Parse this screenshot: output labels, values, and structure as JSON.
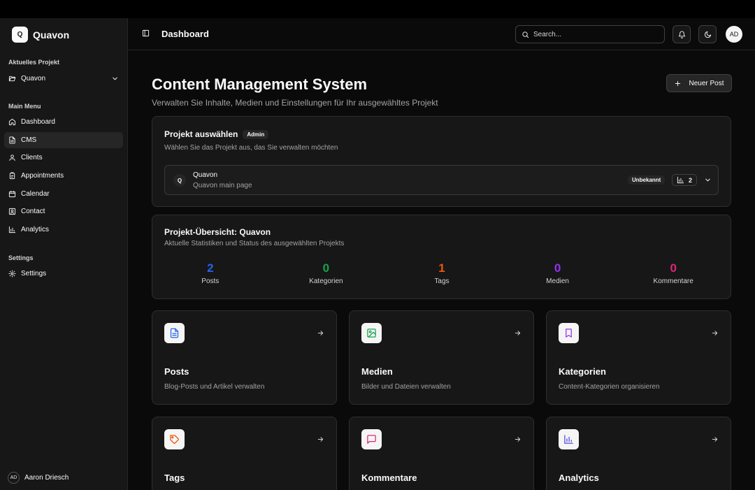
{
  "sidebar": {
    "brand_initial": "Q",
    "brand_name": "Quavon",
    "project_section": "Aktuelles Projekt",
    "project_name": "Quavon",
    "menu_section": "Main Menu",
    "items": [
      {
        "label": "Dashboard",
        "icon": "home-icon"
      },
      {
        "label": "CMS",
        "icon": "file-text-icon"
      },
      {
        "label": "Clients",
        "icon": "user-icon"
      },
      {
        "label": "Appointments",
        "icon": "clipboard-icon"
      },
      {
        "label": "Calendar",
        "icon": "calendar-icon"
      },
      {
        "label": "Contact",
        "icon": "contact-icon"
      },
      {
        "label": "Analytics",
        "icon": "bar-chart-icon"
      }
    ],
    "settings_section": "Settings",
    "settings_item": "Settings",
    "user_initials": "AD",
    "user_name": "Aaron Driesch"
  },
  "header": {
    "title": "Dashboard",
    "search_placeholder": "Search...",
    "avatar_initials": "AD"
  },
  "page": {
    "title": "Content Management System",
    "subtitle": "Verwalten Sie Inhalte, Medien und Einstellungen für Ihr ausgewähltes Projekt",
    "new_post_label": "Neuer Post"
  },
  "project_card": {
    "title": "Projekt auswählen",
    "badge": "Admin",
    "description": "Wählen Sie das Projekt aus, das Sie verwalten möchten",
    "project_initial": "Q",
    "project_name": "Quavon",
    "project_desc": "Quavon main page",
    "status": "Unbekannt",
    "count": "2"
  },
  "overview": {
    "title": "Projekt-Übersicht: Quavon",
    "description": "Aktuelle Statistiken und Status des ausgewählten Projekts",
    "stats": [
      {
        "value": "2",
        "label": "Posts",
        "color": "#2563eb"
      },
      {
        "value": "0",
        "label": "Kategorien",
        "color": "#16a34a"
      },
      {
        "value": "1",
        "label": "Tags",
        "color": "#ea580c"
      },
      {
        "value": "0",
        "label": "Medien",
        "color": "#9333ea"
      },
      {
        "value": "0",
        "label": "Kommentare",
        "color": "#db2777"
      }
    ]
  },
  "tiles": [
    {
      "title": "Posts",
      "desc": "Blog-Posts und Artikel verwalten",
      "icon": "file-text-icon",
      "color": "#2563eb"
    },
    {
      "title": "Medien",
      "desc": "Bilder und Dateien verwalten",
      "icon": "image-icon",
      "color": "#16a34a"
    },
    {
      "title": "Kategorien",
      "desc": "Content-Kategorien organisieren",
      "icon": "bookmark-icon",
      "color": "#9333ea"
    },
    {
      "title": "Tags",
      "desc": "",
      "icon": "tag-icon",
      "color": "#ea580c"
    },
    {
      "title": "Kommentare",
      "desc": "",
      "icon": "message-icon",
      "color": "#db2777"
    },
    {
      "title": "Analytics",
      "desc": "",
      "icon": "bar-chart-icon",
      "color": "#4f46e5"
    }
  ]
}
